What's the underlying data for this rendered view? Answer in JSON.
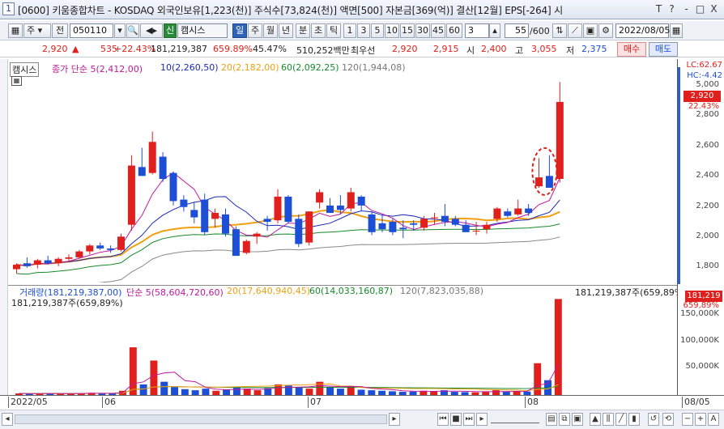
{
  "window": {
    "number": "1",
    "title": "[0600] 키움종합차트 - KOSDAQ 외국인보유[1,223(천)] 주식수[73,824(천)] 액면[500] 자본금[369(억)] 결산[12월] EPS[-264] 시",
    "buttons": [
      "T",
      "?",
      "-",
      "□",
      "X"
    ]
  },
  "toolbar": {
    "type_select": "주",
    "prev_label": "전",
    "code": "050110",
    "stock_name": "캠시스",
    "prefix": "신",
    "periods": [
      "일",
      "주",
      "월",
      "년",
      "분",
      "초",
      "틱"
    ],
    "active_period": "일",
    "intervals": [
      "1",
      "3",
      "5",
      "10",
      "15",
      "30",
      "45",
      "60"
    ],
    "interval_value": "3",
    "count": "55",
    "count_total": "/600",
    "date": "2022/08/05"
  },
  "quote": {
    "price": "2,920",
    "arrow": "▲",
    "change": "535",
    "rate": "+22.43%",
    "volume": "181,219,387",
    "vol_ratio": "659.89%",
    "turnover": "45.47%",
    "amount": "510,252백만",
    "priority": "최우선",
    "bid1": "2,920",
    "ask1": "2,915",
    "open_label": "시",
    "open": "2,400",
    "high_label": "고",
    "high": "3,055",
    "low_label": "저",
    "low": "2,375",
    "buy_label": "매수",
    "sell_label": "매도"
  },
  "price_legend": {
    "name": "캠시스",
    "items": [
      {
        "text": "종가 단순 5(2,412,00)",
        "color": "#c0189c"
      },
      {
        "text": "10(2,260,50)",
        "color": "#1a2ab8"
      },
      {
        "text": "20(2,182,00)",
        "color": "#f0a010"
      },
      {
        "text": "60(2,092,25)",
        "color": "#158a2a"
      },
      {
        "text": "120(1,944,08)",
        "color": "#777777"
      }
    ]
  },
  "price_axis": {
    "labels": [
      "LC:62.67",
      "HC:-4.42",
      "5,000",
      "2,920",
      "22.43%"
    ],
    "ticks": [
      "2,800",
      "2,600",
      "2,400",
      "2,200",
      "2,000",
      "1,800"
    ]
  },
  "volume_legend": {
    "items": [
      {
        "text": "거래량(181,219,387,00)",
        "color": "#1d4fd6"
      },
      {
        "text": "단순 5(58,604,720,60)",
        "color": "#c0189c"
      },
      {
        "text": "20(17,640,940,45)",
        "color": "#f0a010"
      },
      {
        "text": "60(14,033,160,87)",
        "color": "#158a2a"
      },
      {
        "text": "120(7,823,035,88)",
        "color": "#777777"
      }
    ],
    "current": "181,219,387주(659,89%)",
    "current_right": "181,219,387주(659,89%)",
    "tag": "181,219",
    "tag_pct": "659,89%",
    "ticks": [
      "150,000K",
      "100,000K",
      "50,000K"
    ]
  },
  "x_axis": [
    "2022/05",
    "06",
    "07",
    "08",
    "08/05"
  ],
  "chart_data": {
    "type": "candlestick",
    "ylim": [
      1700,
      3100
    ],
    "candles": [
      {
        "o": 1790,
        "h": 1830,
        "l": 1760,
        "c": 1820
      },
      {
        "o": 1830,
        "h": 1870,
        "l": 1800,
        "c": 1810
      },
      {
        "o": 1820,
        "h": 1860,
        "l": 1795,
        "c": 1850
      },
      {
        "o": 1850,
        "h": 1880,
        "l": 1820,
        "c": 1830
      },
      {
        "o": 1830,
        "h": 1870,
        "l": 1810,
        "c": 1860
      },
      {
        "o": 1860,
        "h": 1890,
        "l": 1840,
        "c": 1870
      },
      {
        "o": 1870,
        "h": 1920,
        "l": 1860,
        "c": 1910
      },
      {
        "o": 1910,
        "h": 1960,
        "l": 1890,
        "c": 1950
      },
      {
        "o": 1950,
        "h": 1970,
        "l": 1920,
        "c": 1930
      },
      {
        "o": 1930,
        "h": 1950,
        "l": 1900,
        "c": 1920
      },
      {
        "o": 1920,
        "h": 2030,
        "l": 1910,
        "c": 2010
      },
      {
        "o": 2090,
        "h": 2560,
        "l": 2050,
        "c": 2490
      },
      {
        "o": 2480,
        "h": 2610,
        "l": 2420,
        "c": 2420
      },
      {
        "o": 2440,
        "h": 2720,
        "l": 2430,
        "c": 2650
      },
      {
        "o": 2550,
        "h": 2580,
        "l": 2380,
        "c": 2400
      },
      {
        "o": 2440,
        "h": 2450,
        "l": 2220,
        "c": 2250
      },
      {
        "o": 2260,
        "h": 2290,
        "l": 2180,
        "c": 2210
      },
      {
        "o": 2190,
        "h": 2240,
        "l": 2100,
        "c": 2140
      },
      {
        "o": 2260,
        "h": 2300,
        "l": 2020,
        "c": 2040
      },
      {
        "o": 2130,
        "h": 2200,
        "l": 2070,
        "c": 2170
      },
      {
        "o": 2160,
        "h": 2200,
        "l": 2010,
        "c": 2030
      },
      {
        "o": 2060,
        "h": 2080,
        "l": 1880,
        "c": 1880
      },
      {
        "o": 1900,
        "h": 1990,
        "l": 1890,
        "c": 1980
      },
      {
        "o": 2010,
        "h": 2040,
        "l": 1960,
        "c": 2030
      },
      {
        "o": 2130,
        "h": 2150,
        "l": 2050,
        "c": 2110
      },
      {
        "o": 2120,
        "h": 2330,
        "l": 2100,
        "c": 2280
      },
      {
        "o": 2280,
        "h": 2290,
        "l": 2100,
        "c": 2110
      },
      {
        "o": 2130,
        "h": 2160,
        "l": 1940,
        "c": 1960
      },
      {
        "o": 1970,
        "h": 2180,
        "l": 1950,
        "c": 2180
      },
      {
        "o": 2240,
        "h": 2330,
        "l": 2200,
        "c": 2310
      },
      {
        "o": 2220,
        "h": 2270,
        "l": 2170,
        "c": 2170
      },
      {
        "o": 2220,
        "h": 2290,
        "l": 2160,
        "c": 2190
      },
      {
        "o": 2200,
        "h": 2340,
        "l": 2180,
        "c": 2310
      },
      {
        "o": 2280,
        "h": 2290,
        "l": 2180,
        "c": 2220
      },
      {
        "o": 2160,
        "h": 2180,
        "l": 2020,
        "c": 2040
      },
      {
        "o": 2100,
        "h": 2160,
        "l": 2040,
        "c": 2060
      },
      {
        "o": 2110,
        "h": 2130,
        "l": 2020,
        "c": 2040
      },
      {
        "o": 2070,
        "h": 2120,
        "l": 2000,
        "c": 2060
      },
      {
        "o": 2100,
        "h": 2120,
        "l": 2050,
        "c": 2090
      },
      {
        "o": 2070,
        "h": 2150,
        "l": 2050,
        "c": 2130
      },
      {
        "o": 2140,
        "h": 2170,
        "l": 2090,
        "c": 2140
      },
      {
        "o": 2150,
        "h": 2230,
        "l": 2080,
        "c": 2110
      },
      {
        "o": 2130,
        "h": 2150,
        "l": 2080,
        "c": 2090
      },
      {
        "o": 2090,
        "h": 2120,
        "l": 2040,
        "c": 2040
      },
      {
        "o": 2050,
        "h": 2110,
        "l": 2020,
        "c": 2050
      },
      {
        "o": 2060,
        "h": 2110,
        "l": 2030,
        "c": 2090
      },
      {
        "o": 2130,
        "h": 2210,
        "l": 2110,
        "c": 2200
      },
      {
        "o": 2180,
        "h": 2200,
        "l": 2140,
        "c": 2150
      },
      {
        "o": 2160,
        "h": 2260,
        "l": 2150,
        "c": 2200
      },
      {
        "o": 2200,
        "h": 2230,
        "l": 2150,
        "c": 2170
      },
      {
        "o": 2350,
        "h": 2540,
        "l": 2340,
        "c": 2410
      },
      {
        "o": 2420,
        "h": 2560,
        "l": 2400,
        "c": 2340
      },
      {
        "o": 2400,
        "h": 3055,
        "l": 2375,
        "c": 2920
      }
    ],
    "volume_k": [
      3000,
      2500,
      2800,
      3000,
      2600,
      2700,
      3500,
      4200,
      3000,
      2800,
      8000,
      90000,
      20000,
      65000,
      25000,
      15000,
      11000,
      9000,
      12000,
      8000,
      10000,
      14000,
      12000,
      9000,
      13000,
      20000,
      18000,
      14000,
      12000,
      25000,
      15000,
      12000,
      17000,
      10000,
      9000,
      8000,
      7000,
      6000,
      6500,
      8000,
      7000,
      9000,
      6000,
      5500,
      5000,
      6000,
      9000,
      7000,
      7500,
      6500,
      60000,
      28000,
      181219
    ],
    "highlight_index": 51
  }
}
